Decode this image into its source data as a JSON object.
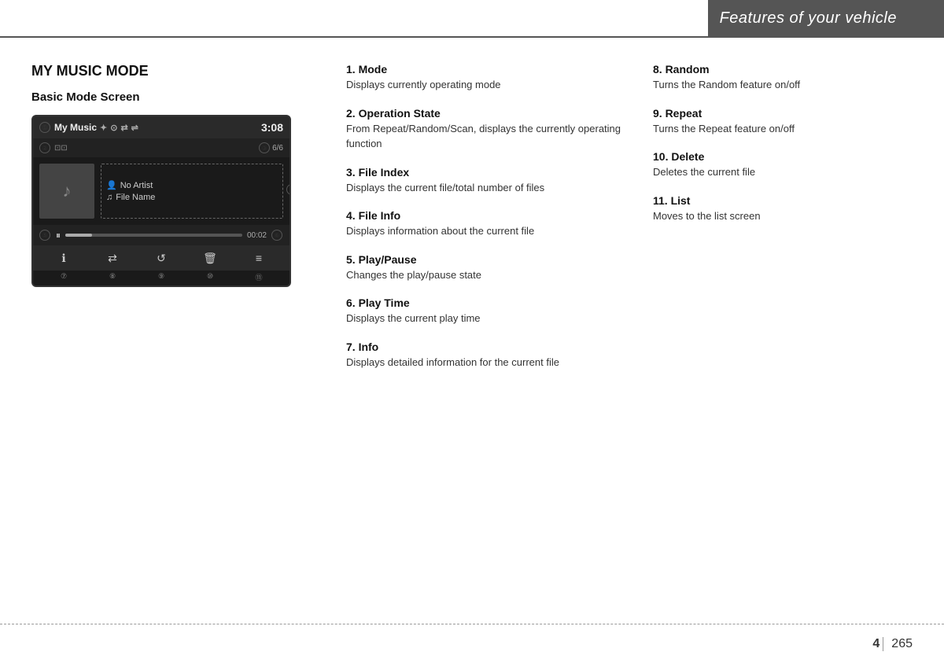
{
  "header": {
    "title": "Features of your vehicle"
  },
  "page": {
    "section_number": "4",
    "page_number": "265"
  },
  "left_section": {
    "title": "MY MUSIC MODE",
    "subtitle": "Basic Mode Screen",
    "screen": {
      "mode_label": "My Music",
      "time": "3:08",
      "track_count": "6/6",
      "artist": "No Artist",
      "filename": "File Name",
      "play_time": "00:02",
      "circle_nums": [
        "①",
        "②",
        "③",
        "④",
        "⑤",
        "⑥",
        "⑦",
        "⑧",
        "⑨",
        "⑩",
        "⑪"
      ]
    }
  },
  "middle_section": {
    "items": [
      {
        "number": "1",
        "title": "Mode",
        "description": "Displays currently operating mode"
      },
      {
        "number": "2",
        "title": "Operation State",
        "description": "From Repeat/Random/Scan, displays the currently operating function"
      },
      {
        "number": "3",
        "title": "File Index",
        "description": "Displays the current file/total number of files"
      },
      {
        "number": "4",
        "title": "File Info",
        "description": "Displays information about the current file"
      },
      {
        "number": "5",
        "title": "Play/Pause",
        "description": "Changes the play/pause state"
      },
      {
        "number": "6",
        "title": "Play Time",
        "description": "Displays the current play time"
      },
      {
        "number": "7",
        "title": "Info",
        "description": "Displays detailed information for the current file"
      }
    ]
  },
  "right_section": {
    "items": [
      {
        "number": "8",
        "title": "Random",
        "description": "Turns the Random feature on/off"
      },
      {
        "number": "9",
        "title": "Repeat",
        "description": "Turns the Repeat feature on/off"
      },
      {
        "number": "10",
        "title": "Delete",
        "description": "Deletes the current file"
      },
      {
        "number": "11",
        "title": "List",
        "description": "Moves to the list screen"
      }
    ]
  }
}
